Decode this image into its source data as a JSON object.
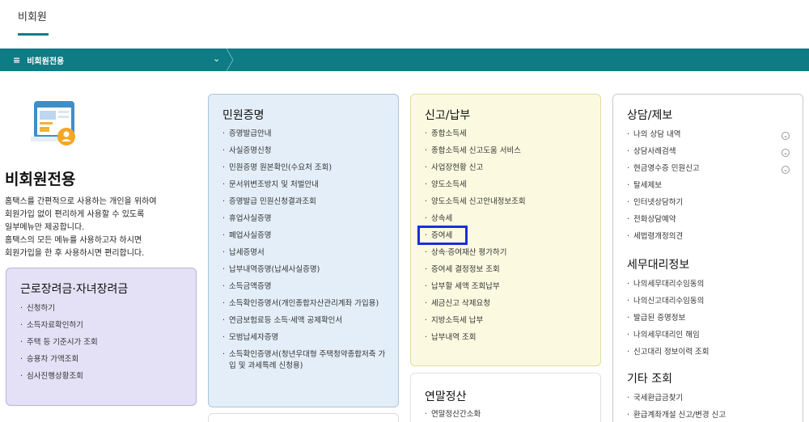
{
  "top_tab": {
    "label": "비회원"
  },
  "navbar": {
    "menu_label": "비회원전용",
    "burger": "≡",
    "chevron": "⌄"
  },
  "intro": {
    "title": "비회원전용",
    "desc": [
      "홈택스를 간편적으로 사용하는 개인을 위하여",
      "회원가입 없이 편리하게 사용할 수 있도록",
      "일부메뉴만 제공합니다.",
      "홈택스의 모든 메뉴를 사용하고자 하시면",
      "회원가입을 한 후 사용하시면 편리합니다."
    ]
  },
  "card_earned_credit": {
    "title": "근로장려금·자녀장려금",
    "items": [
      "신청하기",
      "소득자료확인하기",
      "주택 등 기준시가 조회",
      "승용차 가액조회",
      "심사진행상황조회"
    ]
  },
  "card_certificates": {
    "title": "민원증명",
    "items": [
      "증명발급안내",
      "사실증명신청",
      "민원증명 원본확인(수요처 조회)",
      "문서위변조방지 및 처벌안내",
      "증명발급 민원신청결과조회",
      "휴업사실증명",
      "폐업사실증명",
      "납세증명서",
      "납부내역증명(납세사실증명)",
      "소득금액증명",
      "소득확인증명서(개인종합자산관리계좌 가입용)",
      "연금보험료등 소득·세액 공제확인서",
      "모범납세자증명",
      "소득확인증명서(청년우대형 주택청약종합저축 가입 및 과세특례 신청용)"
    ]
  },
  "card_filing": {
    "title": "신고/납부",
    "items": [
      "종합소득세",
      "종합소득세 신고도움 서비스",
      "사업장현황 신고",
      "양도소득세",
      "양도소득세 신고안내정보조회",
      "상속세",
      "증여세",
      "상속·증여재산 평가하기",
      "증여세 결정정보 조회",
      "납부할 세액 조회납부",
      "세금신고 삭제요청",
      "지방소득세 납부",
      "납부내역 조회"
    ]
  },
  "card_yearend": {
    "title": "연말정산",
    "items": [
      "연말정산간소화"
    ]
  },
  "card_consult": {
    "title": "상담/제보",
    "items": [
      "나의 상담 내역",
      "상담사례검색",
      "현금영수증 민원신고",
      "탈세제보",
      "인터넷상담하기",
      "전화상담예약",
      "세법령개정의견"
    ]
  },
  "card_agent": {
    "title": "세무대리정보",
    "items": [
      "나의세무대리수임동의",
      "나의신고대리수임동의",
      "발급된 증명정보",
      "나의세무대리인 해임",
      "신고대리 정보이력 조회"
    ]
  },
  "card_other": {
    "title": "기타 조회",
    "items": [
      "국세환급금찾기",
      "환급계좌개설 신고/변경 신고"
    ]
  },
  "colors": {
    "nav_teal": "#0d7c84",
    "highlight_blue": "#1a2fd6",
    "purple_card": "#e4e1f6",
    "blue_card": "#e3eef8",
    "yellow_card": "#fbfae0"
  },
  "icons": [
    "menu-icon",
    "chevron-down-icon",
    "nonmember-illustration-icon",
    "expand-circle-icon"
  ]
}
